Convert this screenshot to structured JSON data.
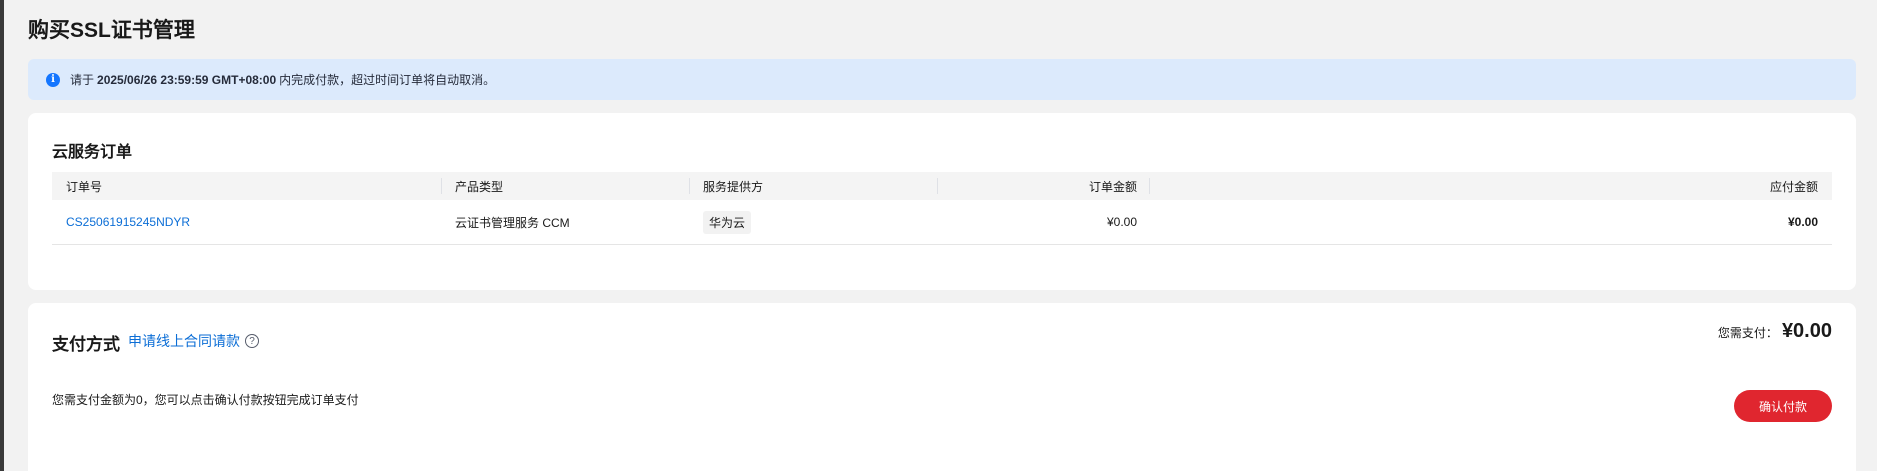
{
  "page": {
    "title": "购买SSL证书管理"
  },
  "notice": {
    "prefix": "请于",
    "deadline": "2025/06/26 23:59:59 GMT+08:00",
    "suffix": "内完成付款，超过时间订单将自动取消。",
    "icon": "info-icon"
  },
  "order": {
    "title": "云服务订单",
    "columns": [
      "订单号",
      "产品类型",
      "服务提供方",
      "订单金额",
      "应付金额"
    ],
    "rows": [
      {
        "order_no": "CS25061915245NDYR",
        "product_type": "云证书管理服务 CCM",
        "provider": "华为云",
        "order_amount": "¥0.00",
        "payable_amount": "¥0.00"
      }
    ]
  },
  "payment": {
    "title": "支付方式",
    "contract_link": "申请线上合同请款",
    "help_icon": "question-circle-icon",
    "summary_label": "您需支付：",
    "summary_amount": "¥0.00",
    "hint": "您需支付金额为0，您可以点击确认付款按钮完成订单支付",
    "confirm_button": "确认付款"
  },
  "colors": {
    "accent": "#e0262f",
    "link": "#0c6ed6",
    "notice_bg": "#dceafc",
    "info": "#1476ff"
  }
}
